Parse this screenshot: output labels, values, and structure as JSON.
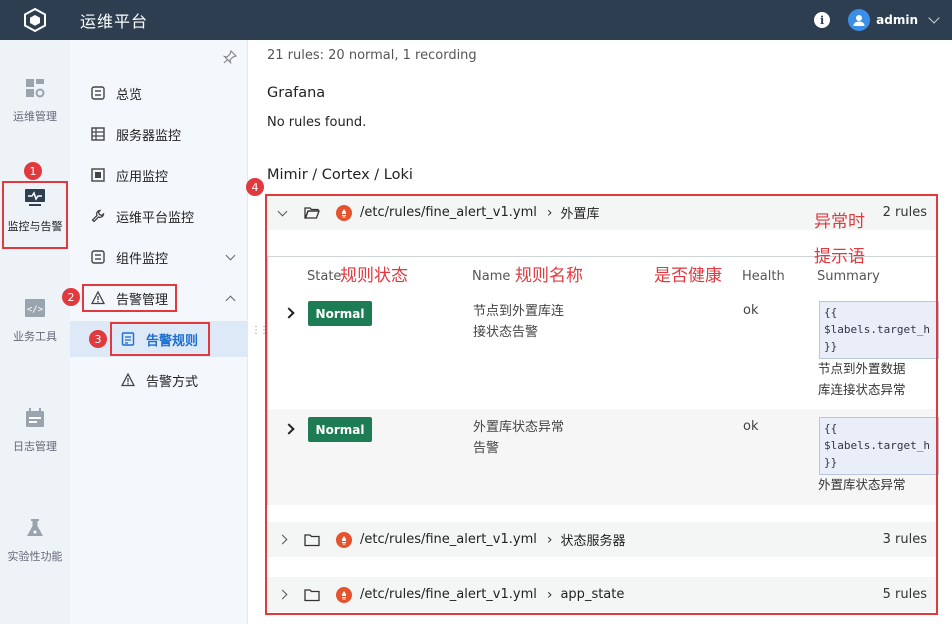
{
  "header": {
    "app_title": "运维平台",
    "user_name": "admin"
  },
  "rail": {
    "items": [
      {
        "label": "运维管理",
        "icon": "dashboard-icon"
      },
      {
        "label": "监控与告警",
        "icon": "monitor-icon"
      },
      {
        "label": "业务工具",
        "icon": "code-icon"
      },
      {
        "label": "日志管理",
        "icon": "calendar-icon"
      },
      {
        "label": "实验性功能",
        "icon": "flask-icon"
      }
    ]
  },
  "subnav": {
    "items": [
      {
        "label": "总览",
        "icon": "overview-icon"
      },
      {
        "label": "服务器监控",
        "icon": "server-icon"
      },
      {
        "label": "应用监控",
        "icon": "app-icon"
      },
      {
        "label": "运维平台监控",
        "icon": "wrench-icon"
      },
      {
        "label": "组件监控",
        "icon": "component-icon"
      },
      {
        "label": "告警管理",
        "icon": "alert-icon"
      },
      {
        "label": "告警规则",
        "icon": "rules-icon"
      },
      {
        "label": "告警方式",
        "icon": "alert-method-icon"
      }
    ]
  },
  "annotations": {
    "badges": [
      "1",
      "2",
      "3",
      "4"
    ],
    "state_label": "规则状态",
    "name_label": "规则名称",
    "health_label": "是否健康",
    "summary_label_1": "异常时",
    "summary_label_2": "提示语"
  },
  "main": {
    "summary": "21 rules: 20 normal, 1 recording",
    "grafana_title": "Grafana",
    "grafana_empty": "No rules found.",
    "mimir_title": "Mimir / Cortex / Loki",
    "groups": [
      {
        "path": "/etc/rules/fine_alert_v1.yml",
        "name": "外置库",
        "count": "2 rules",
        "expanded": true
      },
      {
        "path": "/etc/rules/fine_alert_v1.yml",
        "name": "状态服务器",
        "count": "3 rules",
        "expanded": false
      },
      {
        "path": "/etc/rules/fine_alert_v1.yml",
        "name": "app_state",
        "count": "5 rules",
        "expanded": false
      }
    ],
    "table": {
      "headers": {
        "state": "State",
        "name": "Name",
        "health": "Health",
        "summary": "Summary"
      },
      "rows": [
        {
          "state": "Normal",
          "name_line1": "节点到外置库连",
          "name_line2": "接状态告警",
          "health": "ok",
          "code_1": "{{",
          "code_2": "$labels.target_h",
          "code_3": "}}",
          "summary_line1": "节点到外置数据",
          "summary_line2": "库连接状态异常"
        },
        {
          "state": "Normal",
          "name_line1": "外置库状态异常",
          "name_line2": "告警",
          "health": "ok",
          "code_1": "{{",
          "code_2": "$labels.target_h",
          "code_3": "}}",
          "summary_line1": "外置库状态异常"
        }
      ]
    }
  },
  "colors": {
    "topbar": "#2d3e50",
    "accent": "#1e6fd0",
    "normal_state": "#1e7c55",
    "annotation_red": "#e0393e"
  }
}
